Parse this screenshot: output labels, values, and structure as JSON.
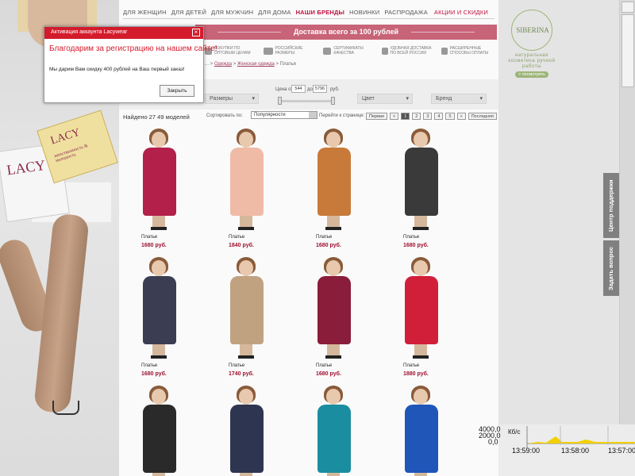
{
  "nav": {
    "items": [
      "ДЛЯ ЖЕНЩИН",
      "ДЛЯ ДЕТЕЙ",
      "ДЛЯ МУЖЧИН",
      "ДЛЯ ДОМА",
      "НАШИ БРЕНДЫ",
      "НОВИНКИ",
      "РАСПРОДАЖА"
    ],
    "promo": "АКЦИИ И СКИДКИ"
  },
  "delivery": "Доставка всего за 100 рублей",
  "features": [
    "ПОКУПКИ ПО ОПТОВЫМ ЦЕНАМ",
    "РОССИЙСКИЕ РАЗМЕРЫ",
    "СЕРТИФИКАТЫ КАЧЕСТВА",
    "УДОБНАЯ ДОСТАВКА ПО ВСЕЙ РОССИИ",
    "РАСШИРЕННЫЕ СПОСОБЫ ОПЛАТЫ"
  ],
  "breadcrumb": {
    "prefix": "...",
    "a": "Одежда",
    "sep": " > ",
    "b": "Женская одежда",
    "c": " > Платья"
  },
  "filters": {
    "sizes": "Размеры",
    "price_label": "Цена от",
    "price_from": "544",
    "price_to_label": "до",
    "price_to": "5796",
    "price_unit": "руб.",
    "color": "Цвет",
    "brand": "Бренд"
  },
  "listing": {
    "found": "Найдено 27 49 моделей",
    "sort_label": "Сортировать по:",
    "sort_value": "Популярности",
    "page_label": "Перейти к странице:",
    "pages": [
      "Первая",
      "<",
      "1",
      "2",
      "3",
      "4",
      "5",
      ">",
      "Последняя"
    ]
  },
  "products": [
    {
      "name": "Платье",
      "price": "1680 руб.",
      "color": "#b3204a"
    },
    {
      "name": "Платье",
      "price": "1840 руб.",
      "color": "#efbba6"
    },
    {
      "name": "Платье",
      "price": "1680 руб.",
      "color": "#c87a3a"
    },
    {
      "name": "Платье",
      "price": "1680 руб.",
      "color": "#3a3a3a"
    },
    {
      "name": "Платье",
      "price": "1680 руб.",
      "color": "#3b3e52"
    },
    {
      "name": "Платье",
      "price": "1740 руб.",
      "color": "#c0a280"
    },
    {
      "name": "Платье",
      "price": "1680 руб.",
      "color": "#8a1d3a"
    },
    {
      "name": "Платье",
      "price": "1880 руб.",
      "color": "#d11f3a"
    },
    {
      "name": "",
      "price": "",
      "color": "#2a2a2a"
    },
    {
      "name": "",
      "price": "",
      "color": "#2e3550"
    },
    {
      "name": "",
      "price": "",
      "color": "#1a8ea0"
    },
    {
      "name": "",
      "price": "",
      "color": "#1f56b8"
    }
  ],
  "popup": {
    "header": "Активация аккаунта Lacywear",
    "title": "Благодарим за регистрацию на нашем сайте!",
    "text": "Мы дарим Вам скидку 400 рублей на Ваш первый заказ!",
    "button": "Закрыть",
    "close": "×"
  },
  "siberina": {
    "brand": "SIBERINA",
    "tagline": "натуральная косметика ручной работы",
    "button": "> посмотреть"
  },
  "side_tabs": {
    "support": "Центр поддержки",
    "ask": "Задать вопрос"
  },
  "graph": {
    "ylabel_top": "4000,0",
    "ylabel_mid": "2000,0",
    "ylabel_bot": "0,0",
    "unit": "Кб/с",
    "times": [
      "13:59:00",
      "13:58:00",
      "13:57:00"
    ]
  },
  "left_bag": {
    "brand": "LACY",
    "slogan": "женственность & молодость"
  }
}
